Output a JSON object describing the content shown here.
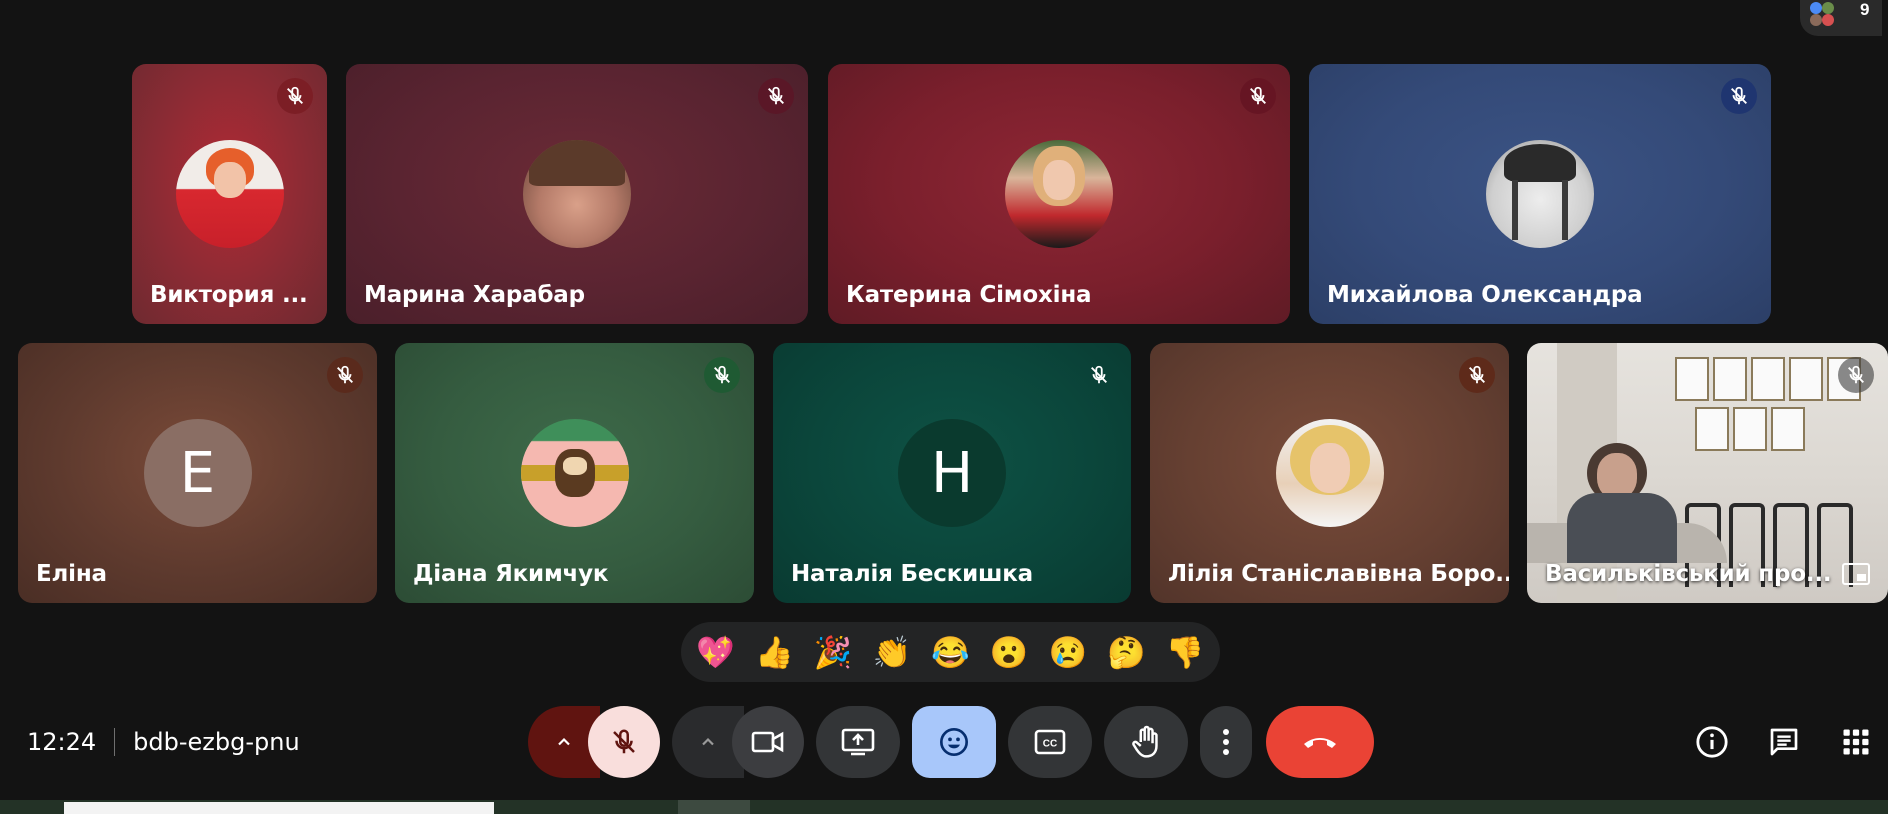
{
  "participants_badge": {
    "count": "9"
  },
  "participants": [
    {
      "name": "Виктория ...",
      "initial": "",
      "muted": true
    },
    {
      "name": "Марина Харабар",
      "initial": "",
      "muted": true
    },
    {
      "name": "Катерина Сімохіна",
      "initial": "",
      "muted": true
    },
    {
      "name": "Михайлова Олександра",
      "initial": "",
      "muted": true
    },
    {
      "name": "Еліна",
      "initial": "E",
      "muted": true
    },
    {
      "name": "Діана Якимчук",
      "initial": "",
      "muted": true
    },
    {
      "name": "Наталія Бескишка",
      "initial": "H",
      "muted": true
    },
    {
      "name": "Лілія Станіславівна Боро...",
      "initial": "",
      "muted": true
    },
    {
      "name": "Васильківський про...",
      "initial": "",
      "muted": true
    }
  ],
  "reactions": [
    "💖",
    "👍",
    "🎉",
    "👏",
    "😂",
    "😮",
    "😢",
    "🤔",
    "👎"
  ],
  "meeting": {
    "time": "12:24",
    "code": "bdb-ezbg-pnu"
  },
  "controls": {
    "mic": "mic-off-icon",
    "camera": "camera-icon",
    "present": "present-screen-icon",
    "emoji": "emoji-icon",
    "captions": "captions-icon",
    "raise_hand": "raise-hand-icon",
    "more": "more-options-icon",
    "leave": "leave-call-icon"
  },
  "right_controls": [
    "info-icon",
    "chat-icon",
    "apps-grid-icon"
  ],
  "colors": {
    "leave": "#ea4335",
    "emoji_active": "#a8c7fa",
    "mic_off": "#f9dedc",
    "mic_chevron": "#601410"
  }
}
